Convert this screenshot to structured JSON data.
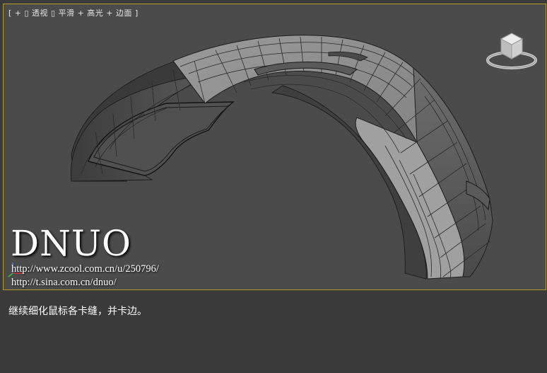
{
  "viewport": {
    "label": "[ + ▯ 透视 ▯ 平滑 + 高光 + 边面 ]"
  },
  "watermark": {
    "title": "DNUO",
    "link_zcool": "http://www.zcool.com.cn/u/250796/",
    "link_sina": "http://t.sina.com.cn/dnuo/"
  },
  "caption": "继续细化鼠标各卡缝，并卡边。",
  "colors": {
    "viewport_border": "#b89a2a",
    "viewport_bg": "#4b4b4b",
    "page_bg": "#3a3a3a"
  },
  "icons": {
    "viewcube": "viewcube-icon",
    "axis": "axis-gizmo-icon"
  }
}
